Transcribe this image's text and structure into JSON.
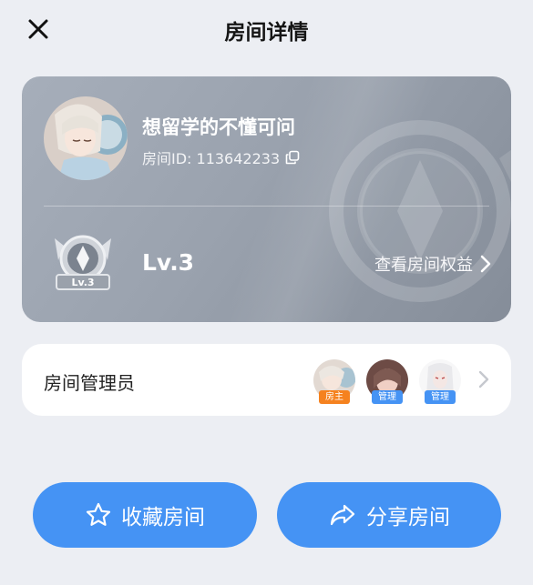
{
  "header": {
    "title": "房间详情"
  },
  "room": {
    "name": "想留学的不懂可问",
    "id_label": "房间ID: 113642233",
    "level": "Lv.3",
    "badge_level": "Lv.3",
    "benefits_link": "查看房间权益"
  },
  "admins": {
    "label": "房间管理员",
    "members": [
      {
        "tag": "房主",
        "tag_color": "#f5821f"
      },
      {
        "tag": "管理",
        "tag_color": "#4593f4"
      },
      {
        "tag": "管理",
        "tag_color": "#4593f4"
      }
    ]
  },
  "actions": {
    "favorite_label": "收藏房间",
    "share_label": "分享房间"
  },
  "colors": {
    "accent": "#4593f4",
    "owner_tag": "#f5821f",
    "page_bg": "#eceef3"
  }
}
